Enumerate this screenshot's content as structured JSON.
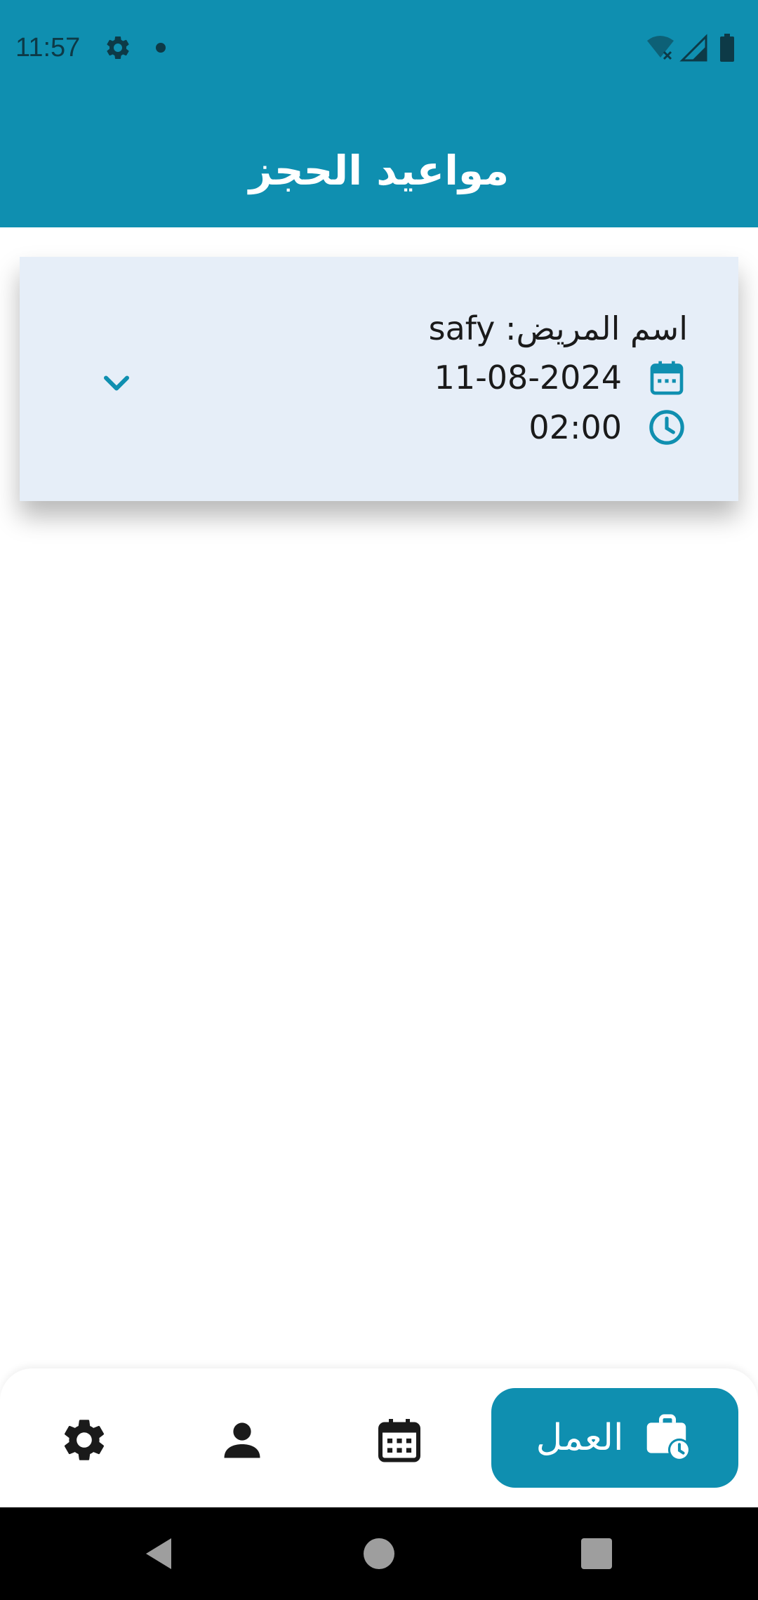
{
  "status_bar": {
    "time": "11:57",
    "icons": [
      "gear-icon",
      "notification-dot-icon",
      "wifi-off-icon",
      "cell-signal-icon",
      "battery-icon"
    ]
  },
  "header": {
    "title": "مواعيد الحجز"
  },
  "appointment_card": {
    "patient_label": "اسم المريض:",
    "patient_name": "safy",
    "date": "11-08-2024",
    "time": "02:00",
    "date_icon": "calendar-icon",
    "time_icon": "clock-icon",
    "expand_icon": "chevron-down-icon"
  },
  "bottom_nav": {
    "items": [
      {
        "icon": "gear-icon",
        "active": false
      },
      {
        "icon": "person-icon",
        "active": false
      },
      {
        "icon": "calendar-icon",
        "active": false
      },
      {
        "icon": "briefcase-clock-icon",
        "label": "العمل",
        "active": true
      }
    ]
  },
  "colors": {
    "primary": "#0f8fb0",
    "card_background": "#e6eef8",
    "text": "#1a1a1a",
    "nav_icon": "#1a1a1a"
  }
}
